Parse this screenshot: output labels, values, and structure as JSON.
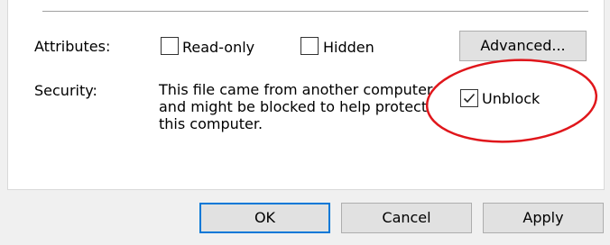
{
  "attributes": {
    "label": "Attributes:",
    "readonly": {
      "label": "Read-only",
      "checked": false
    },
    "hidden": {
      "label": "Hidden",
      "checked": false
    },
    "advanced_button": "Advanced..."
  },
  "security": {
    "label": "Security:",
    "message_lines": [
      "This file came from another computer",
      "and might be blocked to help protect",
      "this computer."
    ],
    "unblock": {
      "label": "Unblock",
      "checked": true
    }
  },
  "footer": {
    "ok": "OK",
    "cancel": "Cancel",
    "apply": "Apply"
  },
  "colors": {
    "annotation_circle": "#e0161b",
    "default_button_border": "#0078d7"
  }
}
